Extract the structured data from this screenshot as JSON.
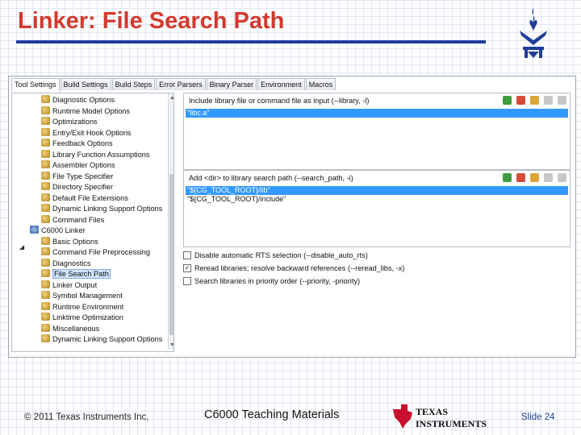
{
  "slide": {
    "title": "Linker: File Search Path",
    "footer_left": "© 2011 Texas Instruments Inc,",
    "footer_center": "C6000 Teaching Materials",
    "footer_right": "Slide 24",
    "ti_logo_text_1": "TEXAS",
    "ti_logo_text_2": "INSTRUMENTS"
  },
  "colors": {
    "title": "#d23a2d",
    "rule": "#1f3d99",
    "selection": "#3399ff",
    "ti_red": "#c8102e"
  },
  "tabs": [
    {
      "label": "Tool Settings",
      "active": true
    },
    {
      "label": "Build Settings"
    },
    {
      "label": "Build Steps"
    },
    {
      "label": "Error Parsers"
    },
    {
      "label": "Binary Parser"
    },
    {
      "label": "Environment"
    },
    {
      "label": "Macros"
    }
  ],
  "tree": {
    "items": [
      {
        "label": "Diagnostic Options",
        "icon": "settings-icon"
      },
      {
        "label": "Runtime Model Options",
        "icon": "settings-icon"
      },
      {
        "label": "Optimizations",
        "icon": "settings-icon"
      },
      {
        "label": "Entry/Exit Hook Options",
        "icon": "settings-icon"
      },
      {
        "label": "Feedback Options",
        "icon": "settings-icon"
      },
      {
        "label": "Library Function Assumptions",
        "icon": "settings-icon"
      },
      {
        "label": "Assembler Options",
        "icon": "settings-icon"
      },
      {
        "label": "File Type Specifier",
        "icon": "settings-icon"
      },
      {
        "label": "Directory Specifier",
        "icon": "settings-icon"
      },
      {
        "label": "Default File Extensions",
        "icon": "settings-icon"
      },
      {
        "label": "Dynamic Linking Support Options",
        "icon": "settings-icon"
      },
      {
        "label": "Command Files",
        "icon": "settings-icon"
      },
      {
        "label": "C6000 Linker",
        "icon": "tool-icon",
        "expanded": true
      },
      {
        "label": "Basic Options",
        "icon": "settings-icon"
      },
      {
        "label": "Command File Preprocessing",
        "icon": "settings-icon"
      },
      {
        "label": "Diagnostics",
        "icon": "settings-icon"
      },
      {
        "label": "File Search Path",
        "icon": "settings-icon",
        "selected": true
      },
      {
        "label": "Linker Output",
        "icon": "settings-icon"
      },
      {
        "label": "Symbol Management",
        "icon": "settings-icon"
      },
      {
        "label": "Runtime Environment",
        "icon": "settings-icon"
      },
      {
        "label": "Linktime Optimization",
        "icon": "settings-icon"
      },
      {
        "label": "Miscellaneous",
        "icon": "settings-icon"
      },
      {
        "label": "Dynamic Linking Support Options",
        "icon": "settings-icon"
      }
    ]
  },
  "include_panel": {
    "label": "Include library file or command file as input (--library, -l)",
    "rows": [
      "\"libc.a\""
    ]
  },
  "search_panel": {
    "label": "Add <dir> to library search path (--search_path, -i)",
    "rows": [
      "\"${CG_TOOL_ROOT}/lib\"",
      "\"${CG_TOOL_ROOT}/include\""
    ]
  },
  "panel_icons": [
    "add-icon",
    "delete-icon",
    "edit-icon",
    "move-up-icon",
    "move-down-icon"
  ],
  "checkboxes": [
    {
      "label": "Disable automatic RTS selection (--disable_auto_rts)",
      "checked": false
    },
    {
      "label": "Reread libraries; resolve backward references (--reread_libs, -x)",
      "checked": true
    },
    {
      "label": "Search libraries in priority order (--priority, -priority)",
      "checked": false
    }
  ]
}
